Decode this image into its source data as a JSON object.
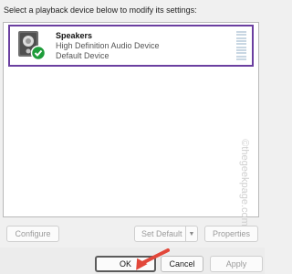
{
  "instruction": "Select a playback device below to modify its settings:",
  "devices": [
    {
      "name": "Speakers",
      "description": "High Definition Audio Device",
      "status": "Default Device",
      "icon": "speaker-icon",
      "badge": "default-check-icon"
    }
  ],
  "watermark": "©thegeekpage.com",
  "buttons": {
    "configure": "Configure",
    "set_default": "Set Default",
    "properties": "Properties",
    "ok": "OK",
    "cancel": "Cancel",
    "apply": "Apply"
  },
  "colors": {
    "selection_border": "#6b3fa0",
    "check_badge": "#1e9c3a",
    "annotation_arrow": "#e2473a"
  }
}
